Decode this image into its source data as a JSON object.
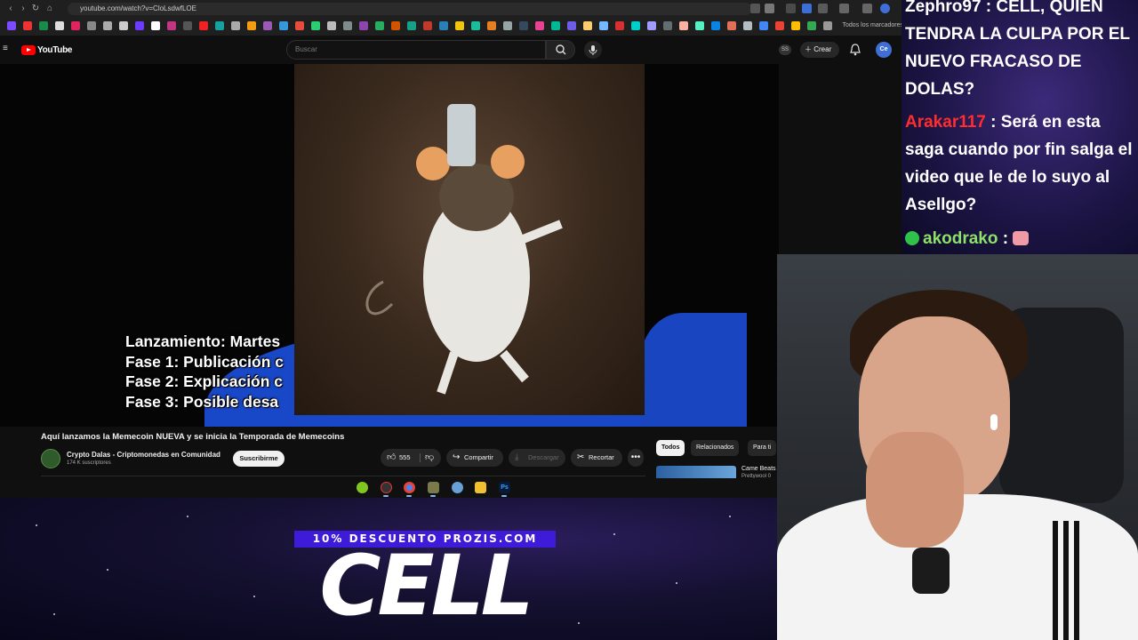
{
  "browser": {
    "url": "youtube.com/watch?v=CloLsdwfLOE",
    "bookmarks_all_label": "Todos los marcadores"
  },
  "youtube": {
    "logo_text": "YouTube",
    "search_placeholder": "Buscar",
    "cast_label": "SS",
    "create_label": "Crear",
    "avatar_text": "Ce",
    "subtitle_lines": [
      "Lanzamiento: Martes",
      "Fase 1: Publicación c",
      "Fase 2: Explicación c",
      "Fase 3: Posible desa"
    ],
    "video_title": "Aquí lanzamos la Memecoin NUEVA y se inicia la Temporada de Memecoins",
    "channel_name": "Crypto Dalas - Criptomonedas en Comunidad",
    "channel_subs": "174 K suscriptores",
    "subscribe_label": "Suscribirme",
    "like_count": "555",
    "share_label": "Compartir",
    "download_label": "Descargar",
    "clip_label": "Recortar",
    "more_label": "•••",
    "chips": [
      "Todos",
      "Relacionados",
      "Para ti"
    ],
    "rec_title": "Came Beats",
    "rec_sub": "Prettywool 0"
  },
  "overlay": {
    "promo": "10% DESCUENTO PROZIS.COM",
    "brand": "CELL"
  },
  "chat": {
    "messages": [
      {
        "user": "Zephro97",
        "sep": " : ",
        "text": "CELL, QUIEN TENDRA LA CULPA POR EL NUEVO FRACASO DE DOLAS?"
      },
      {
        "user": "Arakar117",
        "sep": " : ",
        "text": "Será en esta saga cuando por fin salga el video que le de lo suyo al Asellgo?"
      },
      {
        "user": "akodrako",
        "sep": " : ",
        "text": ""
      }
    ]
  },
  "colors": {
    "youtube_red": "#ff0000",
    "promo_purple": "#3d1bd8",
    "arakar_name": "#ff2d2d",
    "akodrako_name": "#8ee06a"
  }
}
